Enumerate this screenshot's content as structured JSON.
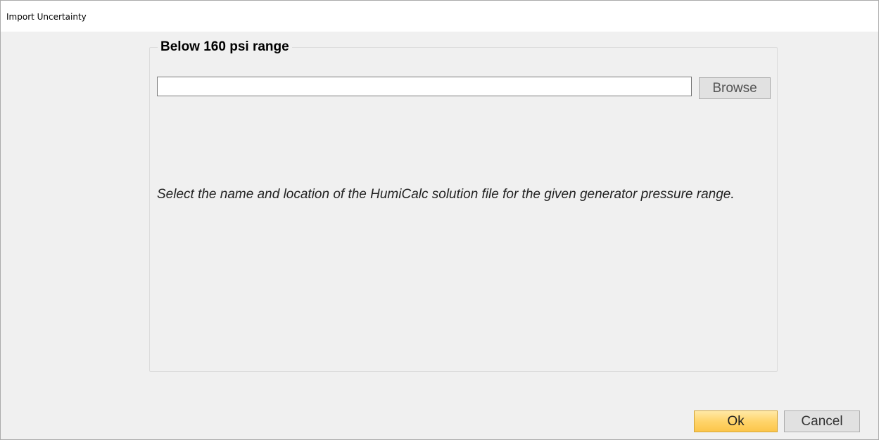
{
  "window": {
    "title": "Import Uncertainty"
  },
  "group": {
    "legend": "Below 160 psi range"
  },
  "file_path": {
    "value": "",
    "placeholder": ""
  },
  "buttons": {
    "browse_label": "Browse",
    "ok_label": "Ok",
    "cancel_label": "Cancel"
  },
  "help_text": "Select the name and location of the HumiCalc solution file for the given generator pressure range.",
  "colors": {
    "ok_accent": "#fcc64a",
    "background": "#f0f0f0"
  }
}
